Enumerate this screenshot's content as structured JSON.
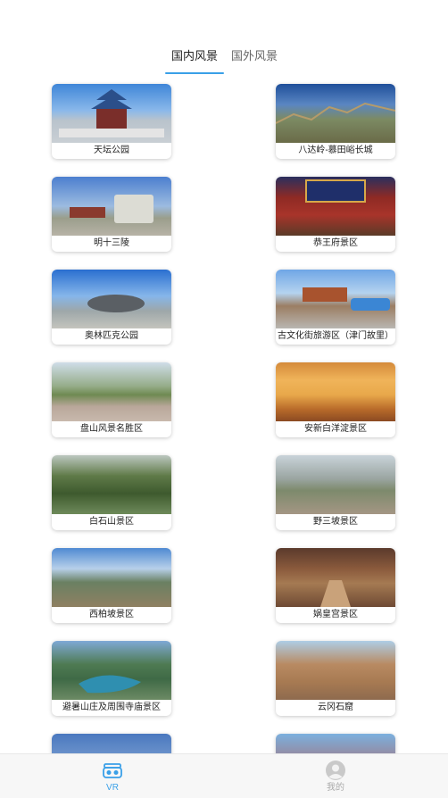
{
  "tabs": {
    "domestic": "国内风景",
    "foreign": "国外风景",
    "active": "domestic"
  },
  "colors": {
    "accent": "#3aa0e8",
    "inactive_nav": "#aaaaaa"
  },
  "scenic_spots": [
    {
      "name": "天坛公园",
      "image": "temple-of-heaven-photo"
    },
    {
      "name": "八达岭-慕田峪长城",
      "image": "great-wall-photo"
    },
    {
      "name": "明十三陵",
      "image": "ming-tombs-photo"
    },
    {
      "name": "恭王府景区",
      "image": "prince-gong-mansion-photo"
    },
    {
      "name": "奥林匹克公园",
      "image": "olympic-park-photo"
    },
    {
      "name": "古文化街旅游区（津门故里）",
      "image": "ancient-culture-street-photo"
    },
    {
      "name": "盘山风景名胜区",
      "image": "panshan-photo"
    },
    {
      "name": "安新白洋淀景区",
      "image": "baiyangdian-photo"
    },
    {
      "name": "白石山景区",
      "image": "baishishan-photo"
    },
    {
      "name": "野三坡景区",
      "image": "yesanpo-photo"
    },
    {
      "name": "西柏坡景区",
      "image": "xibaipo-photo"
    },
    {
      "name": "娲皇宫景区",
      "image": "wahuang-palace-photo"
    },
    {
      "name": "避暑山庄及周围寺庙景区",
      "image": "mountain-resort-photo"
    },
    {
      "name": "云冈石窟",
      "image": "yungang-grottoes-photo"
    }
  ],
  "bottom_nav": {
    "vr": {
      "label": "VR",
      "icon": "vr-headset-icon"
    },
    "mine": {
      "label": "我的",
      "icon": "user-avatar-icon"
    }
  }
}
